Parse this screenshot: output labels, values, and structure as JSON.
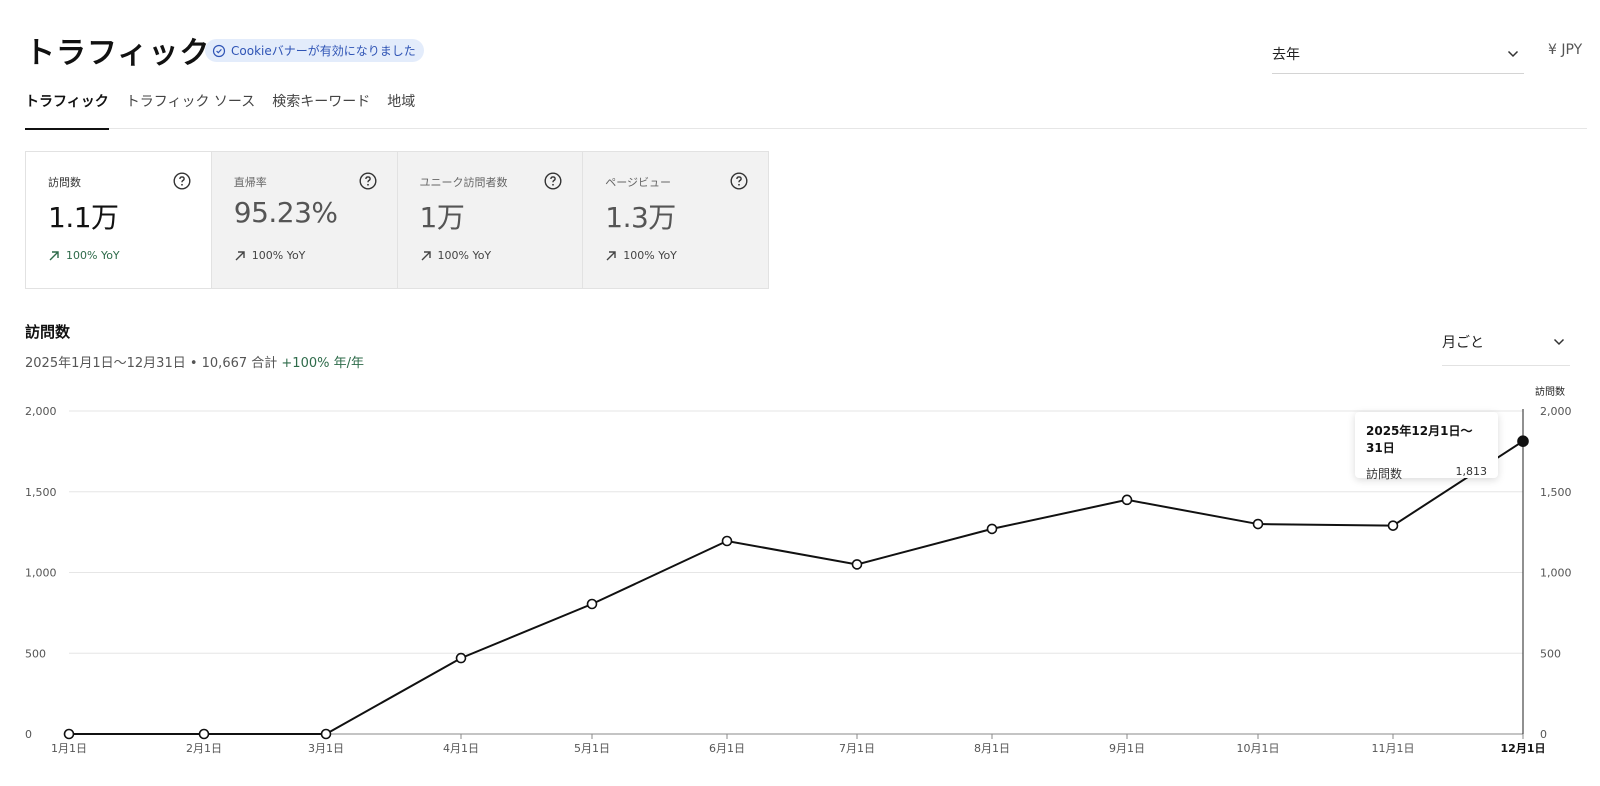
{
  "header": {
    "title": "トラフィック",
    "badge_text": "Cookieバナーが有効になりました",
    "period_value": "去年",
    "currency": "¥ JPY"
  },
  "tabs": [
    {
      "label": "トラフィック",
      "active": true
    },
    {
      "label": "トラフィック ソース",
      "active": false
    },
    {
      "label": "検索キーワード",
      "active": false
    },
    {
      "label": "地域",
      "active": false
    }
  ],
  "metrics": [
    {
      "label": "訪問数",
      "value": "1.1万",
      "yoy": "100% YoY",
      "selected": true
    },
    {
      "label": "直帰率",
      "value": "95.23%",
      "yoy": "100% YoY",
      "selected": false
    },
    {
      "label": "ユニーク訪問者数",
      "value": "1万",
      "yoy": "100% YoY",
      "selected": false
    },
    {
      "label": "ページビュー",
      "value": "1.3万",
      "yoy": "100% YoY",
      "selected": false
    }
  ],
  "section": {
    "title": "訪問数",
    "subtitle": "2025年1月1日〜12月31日 • 10,667 合計",
    "change": "+100% 年/年",
    "granularity": "月ごと"
  },
  "tooltip": {
    "title": "2025年12月1日〜31日",
    "label": "訪問数",
    "value": "1,813"
  },
  "chart_data": {
    "type": "line",
    "categories": [
      "1月1日",
      "2月1日",
      "3月1日",
      "4月1日",
      "5月1日",
      "6月1日",
      "7月1日",
      "8月1日",
      "9月1日",
      "10月1日",
      "11月1日",
      "12月1日"
    ],
    "series": [
      {
        "name": "訪問数",
        "values": [
          0,
          0,
          0,
          470,
          805,
          1195,
          1050,
          1270,
          1450,
          1300,
          1290,
          1813
        ]
      }
    ],
    "right_axis_label": "訪問数",
    "yticks": [
      "0",
      "500",
      "1,000",
      "1,500",
      "2,000"
    ],
    "ylim": [
      0,
      2000
    ],
    "highlighted_index": 11,
    "grid": true
  }
}
